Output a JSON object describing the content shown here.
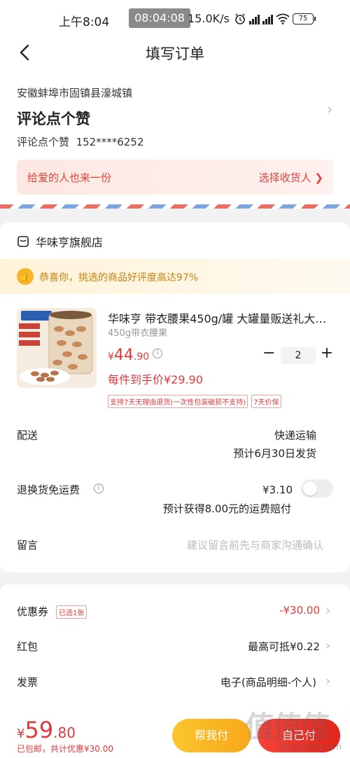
{
  "status_bar": {
    "time": "上午8:04",
    "clock_overlay": "08:04:08",
    "net_speed": "15.0K/s",
    "battery": "75"
  },
  "nav": {
    "title": "填写订单"
  },
  "address": {
    "region": "安徽蚌埠市固镇县濠城镇",
    "name": "评论点个赞",
    "contact_name": "评论点个赞",
    "phone": "152****6252",
    "gift_prompt": "给爱的人也来一份",
    "gift_action": "选择收货人 ❯"
  },
  "store": {
    "name": "华味亨旗舰店",
    "congrats": "恭喜你，挑选的商品好评度高达97%",
    "product": {
      "title": "华味亨 带衣腰果450g/罐 大罐量贩送礼大…",
      "spec": "450g带衣腰果",
      "price_symbol": "¥",
      "price_int": "44",
      "price_dec": ".90",
      "quantity": "2",
      "unit_price": "每件到手价¥29.90",
      "tags": [
        "支持7天无理由退货(一次性包装破损不支持)",
        "7天价保"
      ]
    },
    "delivery": {
      "label": "配送",
      "method": "快递运输",
      "eta": "预计6月30日发货"
    },
    "return_shipping": {
      "label": "退换货免运费",
      "price": "¥3.10",
      "note": "预计获得8.00元的运费赔付"
    },
    "message": {
      "label": "留言",
      "placeholder": "建议留言前先与商家沟通确认"
    }
  },
  "discounts": {
    "coupon": {
      "label": "优惠券",
      "badge": "已选1张",
      "value": "-¥30.00"
    },
    "red_packet": {
      "label": "红包",
      "value": "最高可抵¥0.22"
    },
    "invoice": {
      "label": "发票",
      "value": "电子(商品明细-个人)"
    }
  },
  "bottom": {
    "total_symbol": "¥",
    "total_int": "59",
    "total_dec": ".80",
    "total_sub": "已包邮，共计优惠¥30.00",
    "help_pay": "帮我付",
    "submit": "自己付"
  },
  "watermark": {
    "text": "值值值",
    "sub": "zhizhizhi.com"
  },
  "colors": {
    "accent_red": "#e0393e",
    "help_yellow": "#f7a81b",
    "congrats_orange": "#c7820f"
  }
}
